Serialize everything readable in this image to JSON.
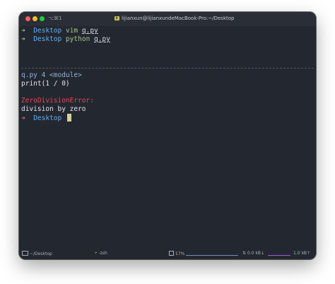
{
  "window": {
    "shortcut": "⌥⌘1",
    "title": "lijianxun@lijianxundeMacBook-Pro:~/Desktop"
  },
  "terminal": {
    "line1": {
      "prompt": "➜",
      "dir": "Desktop",
      "cmd": "vim",
      "arg": "q.py"
    },
    "line2": {
      "prompt": "➜",
      "dir": "Desktop",
      "cmd": "python",
      "arg": "q.py"
    },
    "trace_file": "q.py 4 <module>",
    "trace_code": "print(1 / 0)",
    "error_type": "ZeroDivisionError:",
    "error_msg": "division by zero",
    "line3": {
      "prompt": "➜",
      "dir": "Desktop"
    }
  },
  "statusbar": {
    "path": "~/Desktop",
    "shell": "-zsh",
    "cpu": "17%",
    "net_in": "0.0 kB↓",
    "net_out": "1.0 kB↑"
  },
  "colors": {
    "background": "#232730",
    "prompt_ok": "#98c379",
    "prompt_err": "#e06c75",
    "directory": "#61afef",
    "error": "#e5484d"
  }
}
